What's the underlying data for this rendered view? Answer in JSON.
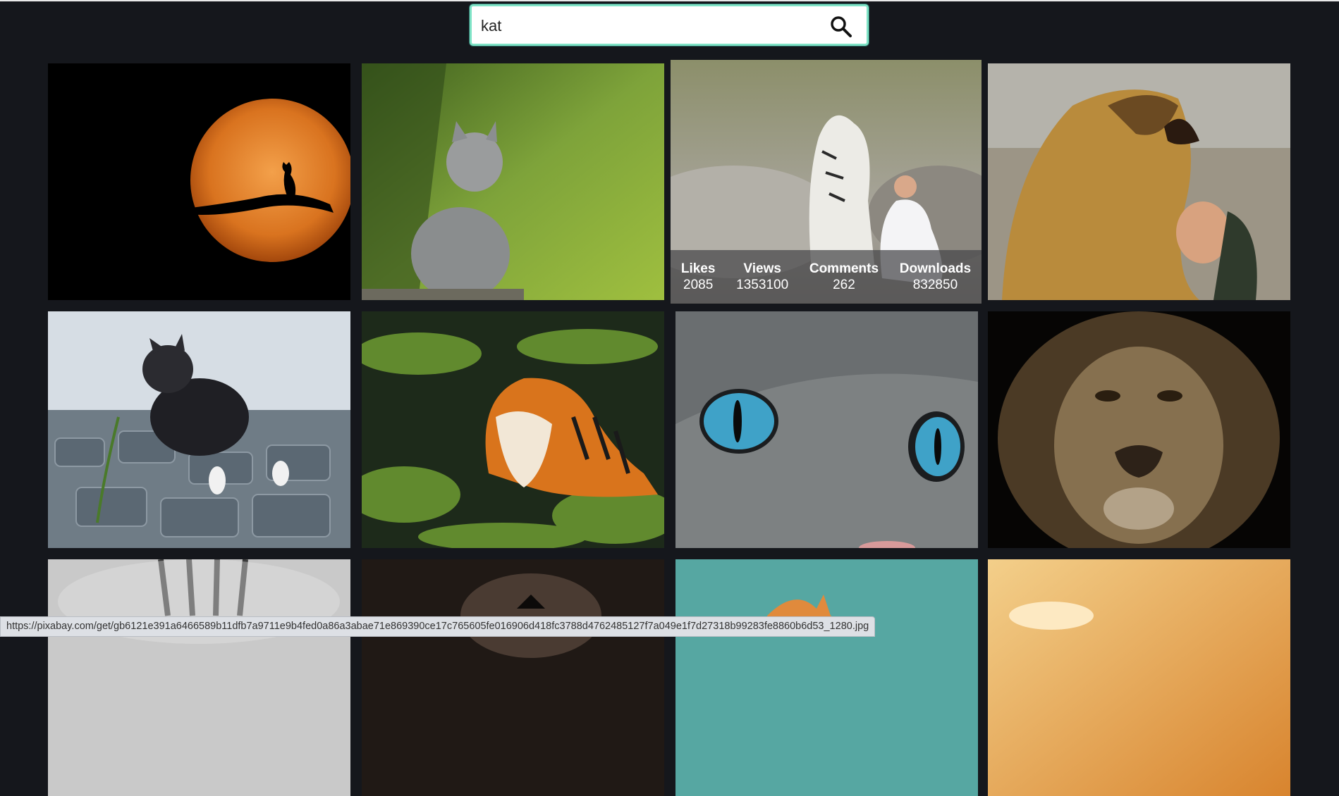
{
  "search": {
    "value": "kat",
    "icon": "search-icon"
  },
  "featured_stats": {
    "likes_label": "Likes",
    "likes_value": "2085",
    "views_label": "Views",
    "views_value": "1353100",
    "comments_label": "Comments",
    "comments_value": "262",
    "downloads_label": "Downloads",
    "downloads_value": "832850"
  },
  "status_url": "https://pixabay.com/get/gb6121e391a6466589b11dfb7a9711e9b4fed0a86a3abae71e869390ce17c765605fe016906d418fc3788d4762485127f7a049e1f7d27318b99283fe8860b6d53_1280.jpg",
  "colors": {
    "page_bg": "#15171c",
    "search_border": "#7fe3c6"
  }
}
